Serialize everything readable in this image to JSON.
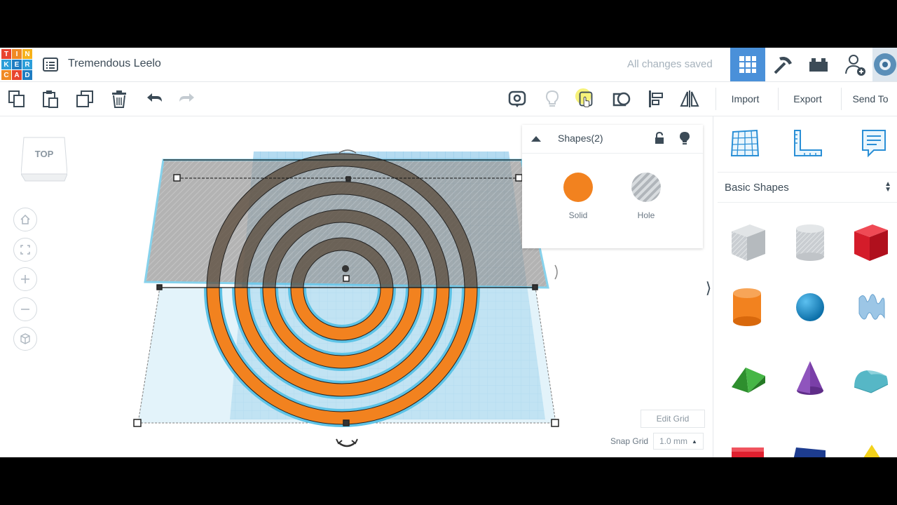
{
  "app": {
    "logo_letters": [
      "T",
      "I",
      "N",
      "K",
      "E",
      "R",
      "C",
      "A",
      "D"
    ],
    "logo_colors": [
      "#e8442e",
      "#f08a24",
      "#f6b21b",
      "#2c9ed9",
      "#1f7dc2",
      "#2c9ed9",
      "#f08a24",
      "#e8442e",
      "#1f7dc2"
    ],
    "design_title": "Tremendous Leelo",
    "status": "All changes saved"
  },
  "nav": {
    "items": [
      {
        "icon": "3d-grid-icon",
        "active": true
      },
      {
        "icon": "pickaxe-icon",
        "active": false
      },
      {
        "icon": "brick-icon",
        "active": false
      },
      {
        "icon": "add-user-icon",
        "active": false
      },
      {
        "icon": "avatar-icon",
        "active": false
      }
    ],
    "accent": "#4a90d9"
  },
  "toolbar": {
    "left_tools": [
      "copy-icon",
      "paste-icon",
      "duplicate-icon",
      "delete-icon",
      "undo-icon",
      "redo-icon"
    ],
    "right_tools": [
      "view-icon",
      "light-bulb-icon",
      "note-icon",
      "workplane-icon",
      "align-icon",
      "mirror-icon"
    ],
    "import_label": "Import",
    "export_label": "Export",
    "send_label": "Send To"
  },
  "viewcube": {
    "label": "TOP"
  },
  "inspector": {
    "title": "Shapes(2)",
    "solid_label": "Solid",
    "hole_label": "Hole",
    "solid_color": "#f2821f"
  },
  "grid": {
    "edit_label": "Edit Grid",
    "snap_label": "Snap Grid",
    "snap_value": "1.0 mm"
  },
  "sidebar": {
    "tools": [
      "workplane-icon",
      "ruler-icon",
      "notes-icon"
    ],
    "category": "Basic Shapes",
    "shapes": [
      {
        "name": "box-hole",
        "color": "#c9cdd1"
      },
      {
        "name": "cylinder-hole",
        "color": "#c9cdd1"
      },
      {
        "name": "box",
        "color": "#e0202f"
      },
      {
        "name": "cylinder",
        "color": "#f2821f"
      },
      {
        "name": "sphere",
        "color": "#1a8fd0"
      },
      {
        "name": "scribble",
        "color": "#9cc6e6"
      },
      {
        "name": "roof",
        "color": "#3aa83a"
      },
      {
        "name": "cone",
        "color": "#7a3fa8"
      },
      {
        "name": "round-roof",
        "color": "#56b7c6"
      }
    ]
  }
}
